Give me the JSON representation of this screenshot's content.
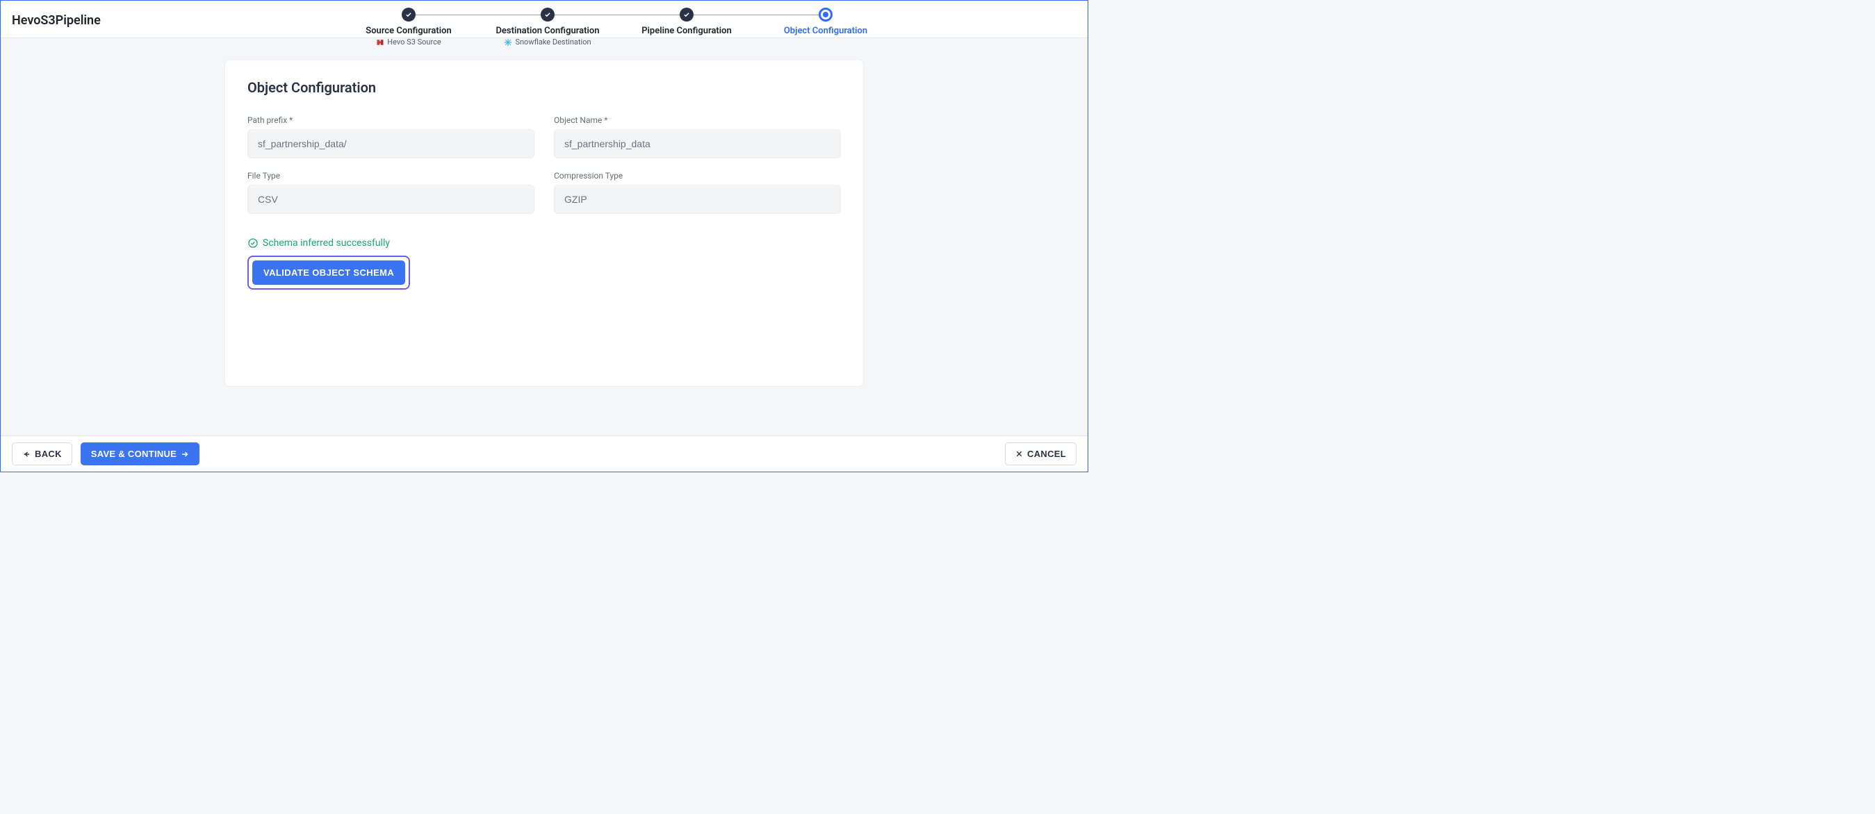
{
  "header": {
    "pipeline_name": "HevoS3Pipeline"
  },
  "stepper": {
    "steps": [
      {
        "label": "Source Configuration",
        "sub": "Hevo S3 Source",
        "sub_icon": "hevo-icon",
        "state": "done"
      },
      {
        "label": "Destination Configuration",
        "sub": "Snowflake Destination",
        "sub_icon": "snowflake-icon",
        "state": "done"
      },
      {
        "label": "Pipeline Configuration",
        "sub": "",
        "state": "done"
      },
      {
        "label": "Object Configuration",
        "sub": "",
        "state": "active"
      }
    ]
  },
  "card": {
    "title": "Object Configuration",
    "fields": {
      "path_prefix": {
        "label": "Path prefix *",
        "value": "sf_partnership_data/"
      },
      "object_name": {
        "label": "Object Name *",
        "value": "sf_partnership_data"
      },
      "file_type": {
        "label": "File Type",
        "value": "CSV"
      },
      "compression": {
        "label": "Compression Type",
        "value": "GZIP"
      }
    },
    "status_text": "Schema inferred successfully",
    "validate_label": "VALIDATE OBJECT SCHEMA"
  },
  "footer": {
    "back_label": "BACK",
    "save_label": "SAVE & CONTINUE",
    "cancel_label": "CANCEL"
  }
}
